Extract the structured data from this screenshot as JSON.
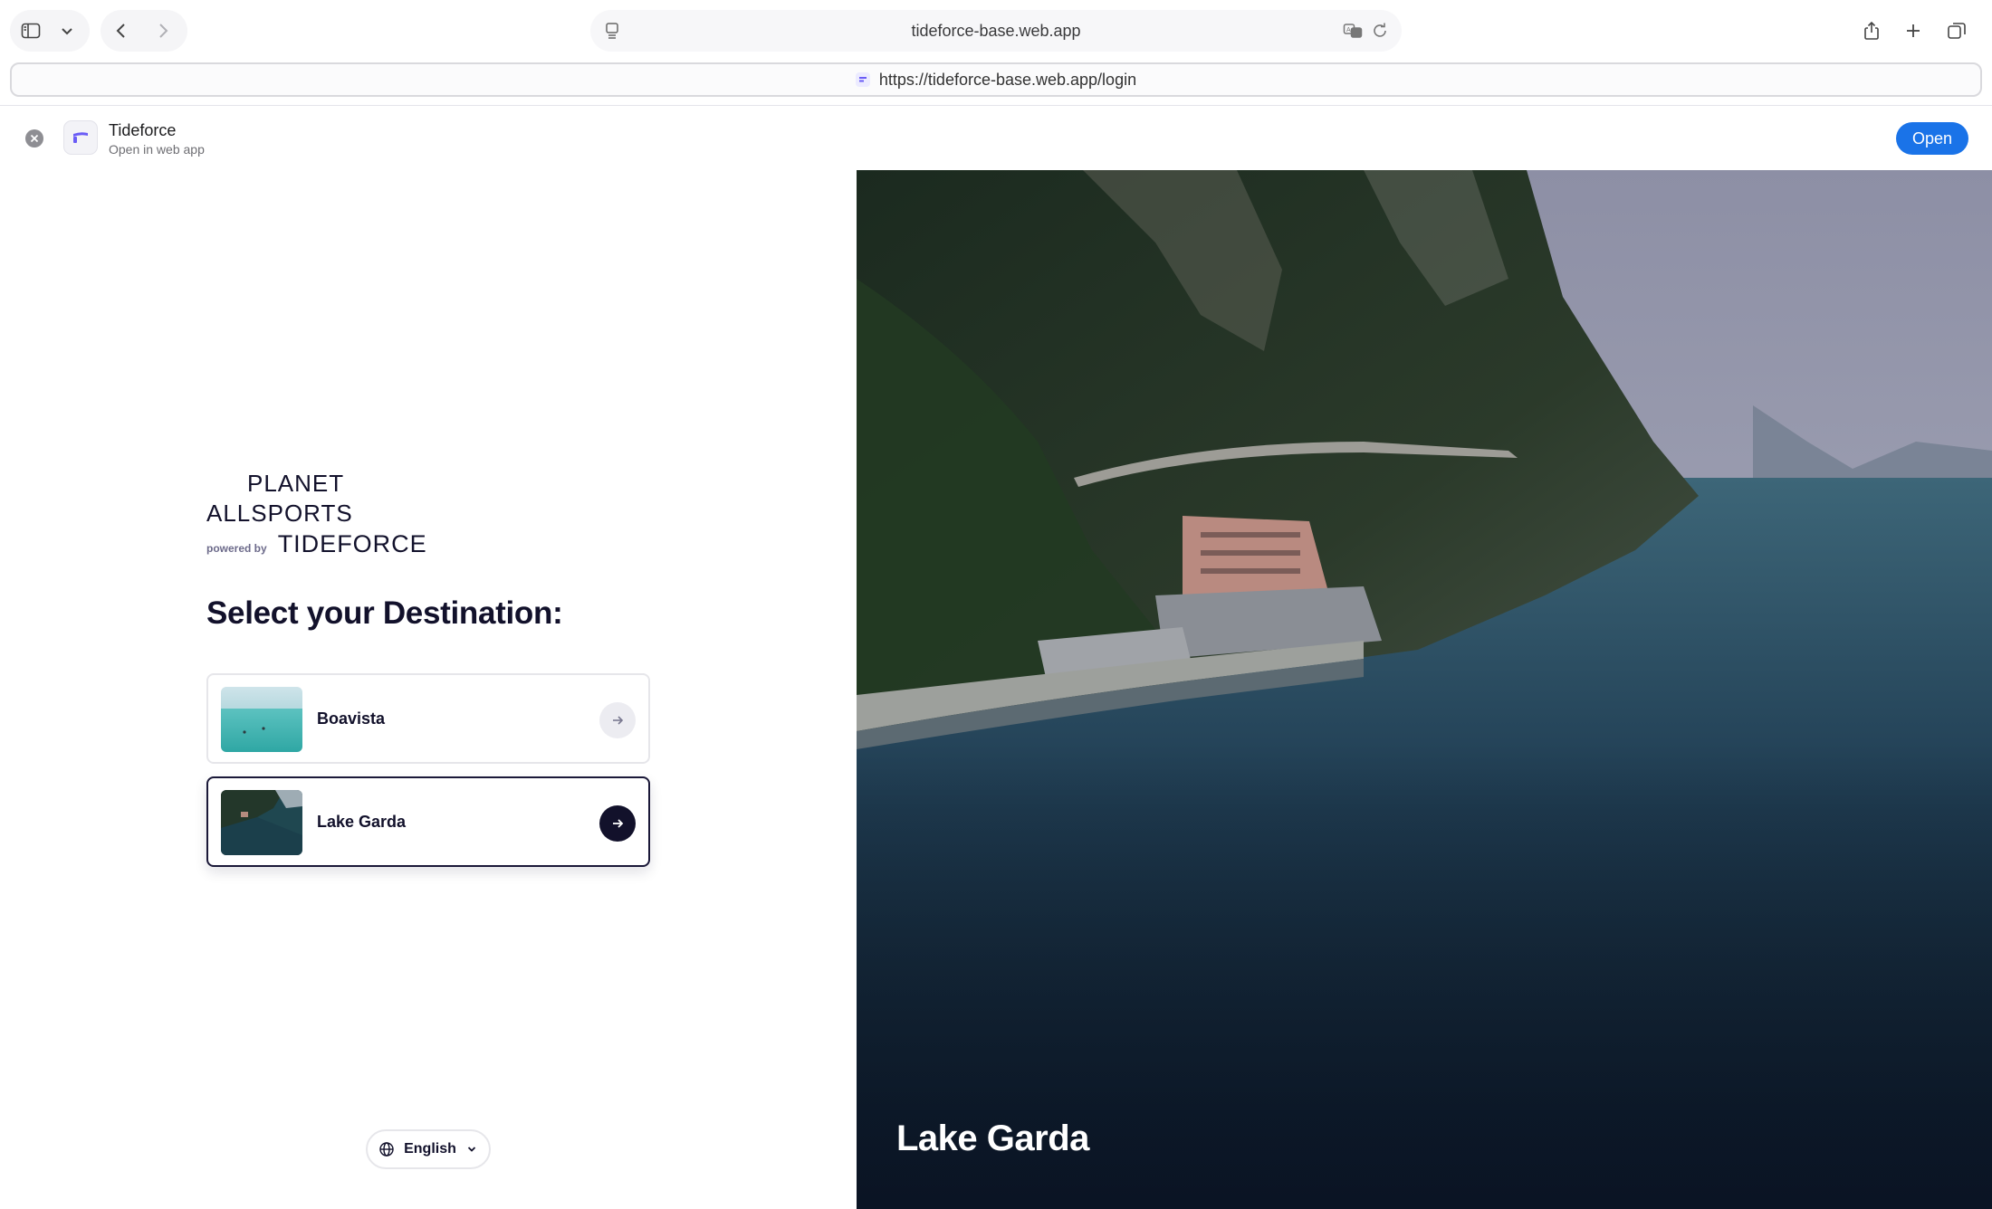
{
  "browser": {
    "address_title": "tideforce-base.web.app",
    "url": "https://tideforce-base.web.app/login"
  },
  "banner": {
    "app_name": "Tideforce",
    "subtitle": "Open in web app",
    "open_label": "Open"
  },
  "login": {
    "logo": {
      "line1": "PLANET",
      "line2": "ALLSPORTS",
      "powered_by": "powered by",
      "brand": "TIDEFORCE"
    },
    "heading": "Select your Destination:",
    "destinations": [
      {
        "label": "Boavista",
        "selected": false
      },
      {
        "label": "Lake Garda",
        "selected": true
      }
    ],
    "language": "English"
  },
  "hero": {
    "title": "Lake Garda"
  },
  "colors": {
    "brand_navy": "#12112b",
    "open_button": "#1a73e8",
    "favicon_accent": "#6a5cf6"
  }
}
